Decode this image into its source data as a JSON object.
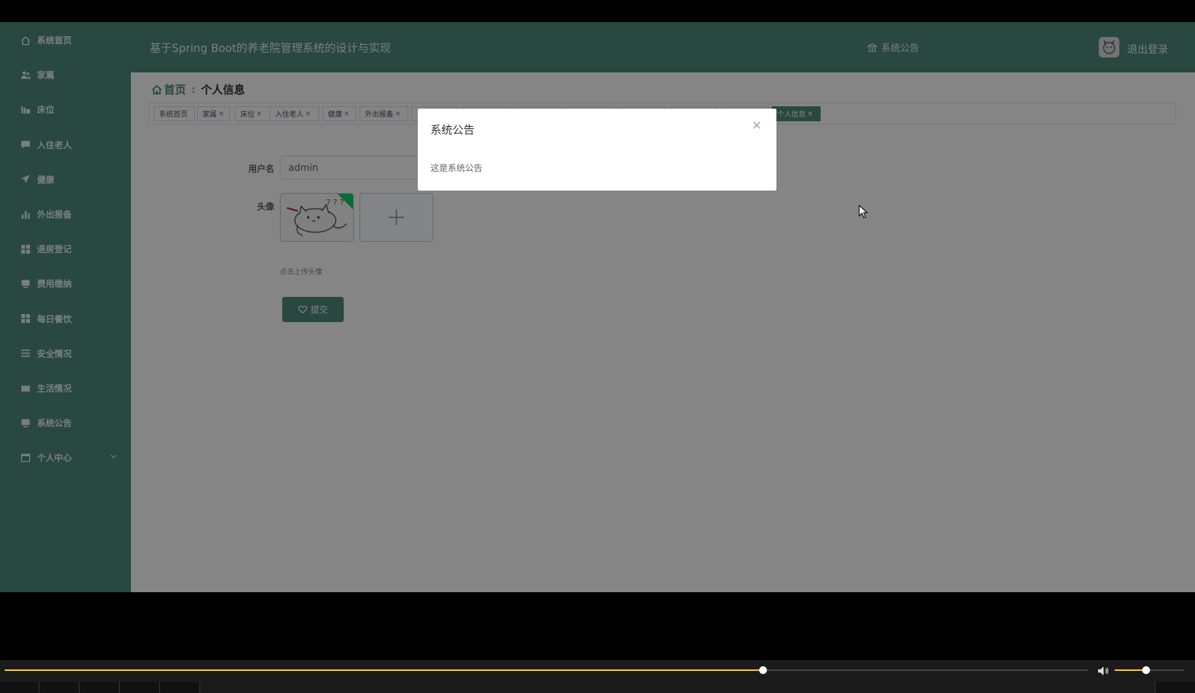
{
  "app": {
    "title": "基于Spring Boot的养老院管理系统的设计与实现",
    "notice_link": "系统公告",
    "logout": "退出登录"
  },
  "sidebar": {
    "items": [
      {
        "label": "系统首页",
        "icon": "home-icon"
      },
      {
        "label": "家属",
        "icon": "people-icon"
      },
      {
        "label": "床位",
        "icon": "bed-icon"
      },
      {
        "label": "入住老人",
        "icon": "chat-icon"
      },
      {
        "label": "健康",
        "icon": "send-icon"
      },
      {
        "label": "外出报备",
        "icon": "bar-chart-icon"
      },
      {
        "label": "退房登记",
        "icon": "grid-icon"
      },
      {
        "label": "费用缴纳",
        "icon": "monitor-icon"
      },
      {
        "label": "每日餐饮",
        "icon": "grid-icon"
      },
      {
        "label": "安全情况",
        "icon": "list-icon"
      },
      {
        "label": "生活情况",
        "icon": "ticket-icon"
      },
      {
        "label": "系统公告",
        "icon": "monitor-icon"
      },
      {
        "label": "个人中心",
        "icon": "window-icon"
      }
    ]
  },
  "breadcrumb": {
    "home": "首页",
    "current": "个人信息"
  },
  "tabs": [
    {
      "label": "系统首页",
      "closable": false
    },
    {
      "label": "家属",
      "closable": true
    },
    {
      "label": "床位",
      "closable": true
    },
    {
      "label": "入住老人",
      "closable": true
    },
    {
      "label": "健康",
      "closable": true
    },
    {
      "label": "外出报备",
      "closable": true
    },
    {
      "label": "",
      "closable": false
    },
    {
      "label": "",
      "closable": false
    },
    {
      "label": "",
      "closable": false
    },
    {
      "label": "",
      "closable": false
    },
    {
      "label": "",
      "closable": false
    },
    {
      "label": "",
      "closable": false
    },
    {
      "label": "",
      "closable": false
    },
    {
      "label": "个人信息",
      "closable": true,
      "active": true
    }
  ],
  "form": {
    "username_label": "用户名",
    "username_value": "admin",
    "avatar_label": "头像",
    "upload_tip": "点击上传头像",
    "submit": "提交"
  },
  "dialog": {
    "title": "系统公告",
    "body": "这是系统公告"
  },
  "player": {
    "progress": 0.7,
    "volume": 0.45
  },
  "colors": {
    "accent": "#4e8a7c",
    "player_fill": "#f2c21b"
  }
}
